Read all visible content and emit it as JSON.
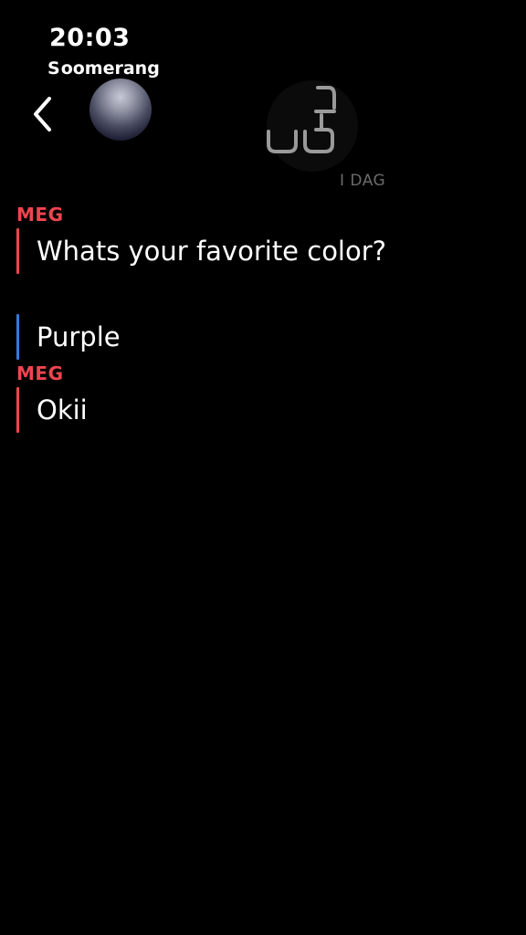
{
  "status_bar": {
    "time": "20:03"
  },
  "watermark": {
    "loop_glyph": "S",
    "text": "oomerang"
  },
  "header": {
    "back_icon": "chevron-left-icon",
    "avatar_icon": "avatar",
    "streak_icon": "snap-streak-icon",
    "streak_label": "I DAG"
  },
  "colors": {
    "me": "#f0444f",
    "friend": "#2f7de1",
    "background": "#000000"
  },
  "messages": [
    {
      "sender": "MEG",
      "text": "Whats your favorite color?",
      "from": "me"
    },
    {
      "sender": "",
      "text": "Purple",
      "from": "friend"
    },
    {
      "sender": "MEG",
      "text": "Okii",
      "from": "me"
    }
  ]
}
